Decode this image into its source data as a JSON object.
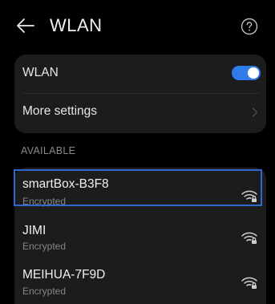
{
  "header": {
    "title": "WLAN",
    "back_icon": "arrow-left-icon",
    "help_icon": "question-circle-icon"
  },
  "settings": {
    "wlan_label": "WLAN",
    "wlan_enabled": true,
    "more_settings_label": "More settings"
  },
  "available": {
    "section_label": "AVAILABLE",
    "networks": [
      {
        "name": "smartBox-B3F8",
        "status": "Encrypted",
        "selected": true
      },
      {
        "name": "JIMI",
        "status": "Encrypted",
        "selected": false
      },
      {
        "name": "MEIHUA-7F9D",
        "status": "Encrypted",
        "selected": false
      }
    ]
  },
  "colors": {
    "accent": "#2f7bea",
    "highlight_border": "#2e67d4",
    "background": "#000000",
    "card": "#1c1c1c"
  }
}
